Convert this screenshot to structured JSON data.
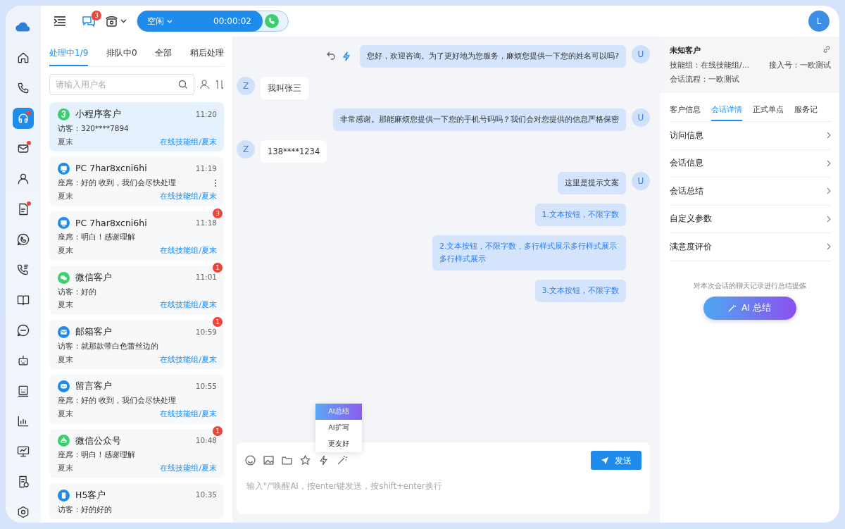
{
  "nav_items": [
    {
      "kind": "cloud",
      "selected": false,
      "dot": false
    },
    {
      "kind": "home",
      "selected": false,
      "dot": false
    },
    {
      "kind": "phone",
      "selected": false,
      "dot": false
    },
    {
      "kind": "headset",
      "selected": true,
      "dot": true
    },
    {
      "kind": "mail",
      "selected": false,
      "dot": true
    },
    {
      "kind": "user",
      "selected": false,
      "dot": false
    },
    {
      "kind": "doc",
      "selected": false,
      "dot": true
    },
    {
      "kind": "chat-phone",
      "selected": false,
      "dot": false
    },
    {
      "kind": "call-list",
      "selected": false,
      "dot": false
    },
    {
      "kind": "book",
      "selected": false,
      "dot": false
    },
    {
      "kind": "sms",
      "selected": false,
      "dot": false
    },
    {
      "kind": "robot",
      "selected": false,
      "dot": false
    },
    {
      "kind": "screen",
      "selected": false,
      "dot": false
    },
    {
      "kind": "bars",
      "selected": false,
      "dot": false
    },
    {
      "kind": "monitor",
      "selected": false,
      "dot": false
    },
    {
      "kind": "report",
      "selected": false,
      "dot": false
    },
    {
      "kind": "hexagon",
      "selected": false,
      "dot": false
    }
  ],
  "top_bar": {
    "message_badge": "3",
    "status": "空闲",
    "timer": "00:00:02",
    "avatar": "L"
  },
  "list_tabs": [
    {
      "label": "处理中1/9",
      "selected": true
    },
    {
      "label": "排队中0",
      "selected": false
    },
    {
      "label": "全部",
      "selected": false
    },
    {
      "label": "稍后处理",
      "selected": false
    }
  ],
  "search": {
    "placeholder": "请输入用户名"
  },
  "conversations": [
    {
      "kind": "miniprogram",
      "color": "#3ccf6e",
      "name": "小程序客户",
      "time": "11:20",
      "preview": "访客：320****7894",
      "agent": "夏末",
      "group": "在线技能组/夏末",
      "selected": true,
      "more_menu": false
    },
    {
      "kind": "pc",
      "color": "#1f8ceb",
      "name": "PC 7har8xcni6hi",
      "time": "11:19",
      "preview": "座席：好的 收到，我们会尽快处理",
      "agent": "夏末",
      "group": "在线技能组/夏末",
      "selected": false,
      "more_menu": true
    },
    {
      "kind": "pc",
      "color": "#1f8ceb",
      "name": "PC 7har8xcni6hi",
      "time": "11:18",
      "preview": "座席：明白！感谢理解",
      "agent": "夏末",
      "group": "在线技能组/夏末",
      "selected": false,
      "unread": "3",
      "more_menu": false
    },
    {
      "kind": "wechat",
      "color": "#3ccf6e",
      "name": "微信客户",
      "time": "11:01",
      "preview": "访客：好的",
      "agent": "夏末",
      "group": "在线技能组/夏末",
      "selected": false,
      "unread": "1",
      "more_menu": false
    },
    {
      "kind": "mail",
      "color": "#1f8ceb",
      "name": "邮箱客户",
      "time": "10:59",
      "preview": "访客：就那款带白色蕾丝边的",
      "agent": "夏末",
      "group": "在线技能组/夏末",
      "selected": false,
      "unread": "1",
      "more_menu": false
    },
    {
      "kind": "message",
      "color": "#1f8ceb",
      "name": "留言客户",
      "time": "10:55",
      "preview": "座席：好的 收到，我们会尽快处理",
      "agent": "夏末",
      "group": "在线技能组/夏末",
      "selected": false,
      "more_menu": false
    },
    {
      "kind": "official",
      "color": "#3ccf6e",
      "name": "微信公众号",
      "time": "10:48",
      "preview": "座席：明白！感谢理解",
      "agent": "夏末",
      "group": "在线技能组/夏末",
      "selected": false,
      "unread": "1",
      "more_menu": false
    },
    {
      "kind": "h5",
      "color": "#1f8ceb",
      "name": "H5客户",
      "time": "10:35",
      "preview": "访客：好的好的",
      "selected": false,
      "more_menu": false
    }
  ],
  "messages": [
    {
      "outgoing": true,
      "kind": "text",
      "avatar": "U",
      "text": "您好，欢迎咨询。为了更好地为您服务，麻烦您提供一下您的姓名可以吗?",
      "actions": true
    },
    {
      "outgoing": false,
      "kind": "text",
      "avatar": "Z",
      "text": "我叫张三",
      "actions": false
    },
    {
      "outgoing": true,
      "kind": "text",
      "avatar": "U",
      "text": "非常感谢。那能麻烦您提供一下您的手机号码吗？我们会对您提供的信息严格保密",
      "actions": false
    },
    {
      "outgoing": false,
      "kind": "text",
      "avatar": "Z",
      "text": "138****1234",
      "actions": false
    },
    {
      "outgoing": true,
      "kind": "text",
      "avatar": "U",
      "text": "这里是提示文案",
      "actions": false
    },
    {
      "outgoing": true,
      "kind": "button",
      "text": "1.文本按钮，不限字数",
      "actions": false
    },
    {
      "outgoing": true,
      "kind": "button",
      "text": "2.文本按钮，不限字数，多行样式展示多行样式展示多行样式展示",
      "actions": false
    },
    {
      "outgoing": true,
      "kind": "button",
      "text": "3.文本按钮，不限字数",
      "actions": false
    }
  ],
  "ai_menu": [
    {
      "label": "AI总结",
      "selected": true
    },
    {
      "label": "AI扩写",
      "selected": false
    },
    {
      "label": "更友好",
      "selected": false
    }
  ],
  "composer": {
    "placeholder": "输入\"/\"唤醒AI，按enter键发送，按shift+enter换行",
    "send": "发送"
  },
  "customer": {
    "name": "未知客户",
    "skill_group": "技能组：在线技能组/...",
    "access_number": "接入号：一欧测试",
    "flow": "会话流程：一欧测试"
  },
  "detail_tabs": [
    {
      "label": "客户信息",
      "selected": false
    },
    {
      "label": "会话详情",
      "selected": true
    },
    {
      "label": "正式单点",
      "selected": false
    },
    {
      "label": "服务记",
      "selected": false
    }
  ],
  "sections": [
    "访问信息",
    "会话信息",
    "会话总结",
    "自定义参数",
    "满意度评价"
  ],
  "summary": {
    "hint": "对本次会话的聊天记录进行总结提炼",
    "button": "AI 总结"
  }
}
